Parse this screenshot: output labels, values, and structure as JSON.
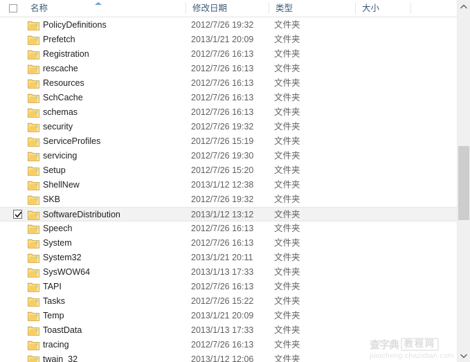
{
  "window": {
    "title": "Windows Explorer file list",
    "view_mode": "details"
  },
  "columns": {
    "name": "名称",
    "date_modified": "修改日期",
    "type": "类型",
    "size": "大小",
    "sort_column": "名称",
    "sort_direction": "ascending"
  },
  "colors": {
    "header_text": "#3c5a78",
    "row_text": "#1d1d1d",
    "secondary_text": "#5f5f5f",
    "selection_bg": "#f2f2f2",
    "folder_yellow": "#f5c451",
    "scrollbar_thumb": "#cdcdcd",
    "sort_arrow": "#6ca0d0"
  },
  "icons": {
    "folder": "folder-icon",
    "checkbox": "checkbox-icon",
    "sort_ascending": "sort-ascending-icon",
    "scroll_up": "chevron-up-icon",
    "scroll_down": "chevron-down-icon"
  },
  "rows": [
    {
      "name": "PolicyDefinitions",
      "date": "2012/7/26 19:32",
      "type": "文件夹",
      "size": "",
      "selected": false
    },
    {
      "name": "Prefetch",
      "date": "2013/1/21 20:09",
      "type": "文件夹",
      "size": "",
      "selected": false
    },
    {
      "name": "Registration",
      "date": "2012/7/26 16:13",
      "type": "文件夹",
      "size": "",
      "selected": false
    },
    {
      "name": "rescache",
      "date": "2012/7/26 16:13",
      "type": "文件夹",
      "size": "",
      "selected": false
    },
    {
      "name": "Resources",
      "date": "2012/7/26 16:13",
      "type": "文件夹",
      "size": "",
      "selected": false
    },
    {
      "name": "SchCache",
      "date": "2012/7/26 16:13",
      "type": "文件夹",
      "size": "",
      "selected": false
    },
    {
      "name": "schemas",
      "date": "2012/7/26 16:13",
      "type": "文件夹",
      "size": "",
      "selected": false
    },
    {
      "name": "security",
      "date": "2012/7/26 19:32",
      "type": "文件夹",
      "size": "",
      "selected": false
    },
    {
      "name": "ServiceProfiles",
      "date": "2012/7/26 15:19",
      "type": "文件夹",
      "size": "",
      "selected": false
    },
    {
      "name": "servicing",
      "date": "2012/7/26 19:30",
      "type": "文件夹",
      "size": "",
      "selected": false
    },
    {
      "name": "Setup",
      "date": "2012/7/26 15:20",
      "type": "文件夹",
      "size": "",
      "selected": false
    },
    {
      "name": "ShellNew",
      "date": "2013/1/12 12:38",
      "type": "文件夹",
      "size": "",
      "selected": false
    },
    {
      "name": "SKB",
      "date": "2012/7/26 19:32",
      "type": "文件夹",
      "size": "",
      "selected": false
    },
    {
      "name": "SoftwareDistribution",
      "date": "2013/1/12 13:12",
      "type": "文件夹",
      "size": "",
      "selected": true
    },
    {
      "name": "Speech",
      "date": "2012/7/26 16:13",
      "type": "文件夹",
      "size": "",
      "selected": false
    },
    {
      "name": "System",
      "date": "2012/7/26 16:13",
      "type": "文件夹",
      "size": "",
      "selected": false
    },
    {
      "name": "System32",
      "date": "2013/1/21 20:11",
      "type": "文件夹",
      "size": "",
      "selected": false
    },
    {
      "name": "SysWOW64",
      "date": "2013/1/13 17:33",
      "type": "文件夹",
      "size": "",
      "selected": false
    },
    {
      "name": "TAPI",
      "date": "2012/7/26 16:13",
      "type": "文件夹",
      "size": "",
      "selected": false
    },
    {
      "name": "Tasks",
      "date": "2012/7/26 15:22",
      "type": "文件夹",
      "size": "",
      "selected": false
    },
    {
      "name": "Temp",
      "date": "2013/1/21 20:09",
      "type": "文件夹",
      "size": "",
      "selected": false
    },
    {
      "name": "ToastData",
      "date": "2013/1/13 17:33",
      "type": "文件夹",
      "size": "",
      "selected": false
    },
    {
      "name": "tracing",
      "date": "2012/7/26 16:13",
      "type": "文件夹",
      "size": "",
      "selected": false
    },
    {
      "name": "twain_32",
      "date": "2013/1/12 12:06",
      "type": "文件夹",
      "size": "",
      "selected": false
    }
  ],
  "watermark": {
    "brand": "查字典",
    "tag": "教程网",
    "url": "jiaocheng.chazidian.com"
  }
}
